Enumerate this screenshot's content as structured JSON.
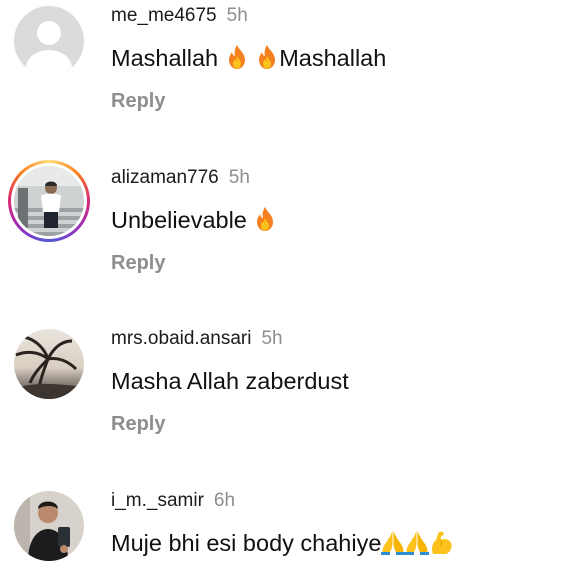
{
  "comments": [
    {
      "username": "me_me4675",
      "time": "5h",
      "text_parts": [
        "Mashallah ",
        " ",
        "Mashallah"
      ],
      "reply_label": "Reply",
      "avatar": "default-avatar-icon"
    },
    {
      "username": "alizaman776",
      "time": "5h",
      "text": "Unbelievable ",
      "reply_label": "Reply",
      "avatar": "profile-photo-with-story-ring"
    },
    {
      "username": "mrs.obaid.ansari",
      "time": "5h",
      "text": "Masha Allah zaberdust",
      "reply_label": "Reply",
      "avatar": "palm-tree-photo"
    },
    {
      "username": "i_m._samir",
      "time": "6h",
      "text": "Muje bhi esi body chahiye",
      "avatar": "mirror-selfie-photo"
    }
  ],
  "icons": {
    "fire": "fire-emoji-icon",
    "folded_hands": "folded-hands-emoji-icon",
    "flexed_biceps": "flexed-biceps-emoji-icon"
  },
  "colors": {
    "username": "#1b1b1b",
    "secondary": "#8e8e8e",
    "text": "#111111"
  }
}
